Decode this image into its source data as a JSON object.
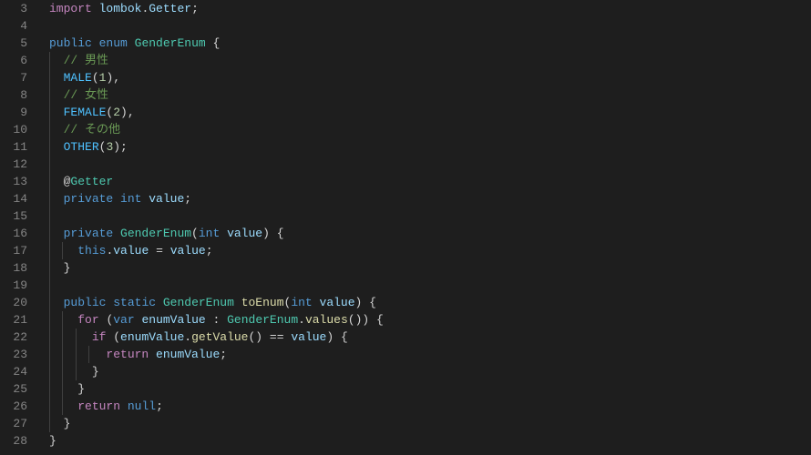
{
  "lines": [
    {
      "num": "3",
      "html": "<span class='kw-control'>import</span> <span class='variable'>lombok</span><span class='punct'>.</span><span class='variable'>Getter</span><span class='punct'>;</span>"
    },
    {
      "num": "4",
      "html": ""
    },
    {
      "num": "5",
      "html": "<span class='kw-modifier'>public</span> <span class='kw-modifier'>enum</span> <span class='class-name'>GenderEnum</span> <span class='punct'>{</span>"
    },
    {
      "num": "6",
      "html": "  <span class='comment'>// 男性</span>"
    },
    {
      "num": "7",
      "html": "  <span class='const'>MALE</span><span class='punct'>(</span><span class='number'>1</span><span class='punct'>),</span>"
    },
    {
      "num": "8",
      "html": "  <span class='comment'>// 女性</span>"
    },
    {
      "num": "9",
      "html": "  <span class='const'>FEMALE</span><span class='punct'>(</span><span class='number'>2</span><span class='punct'>),</span>"
    },
    {
      "num": "10",
      "html": "  <span class='comment'>// その他</span>"
    },
    {
      "num": "11",
      "html": "  <span class='const'>OTHER</span><span class='punct'>(</span><span class='number'>3</span><span class='punct'>);</span>"
    },
    {
      "num": "12",
      "html": ""
    },
    {
      "num": "13",
      "html": "  <span class='punct'>@</span><span class='annotation'>Getter</span>"
    },
    {
      "num": "14",
      "html": "  <span class='kw-modifier'>private</span> <span class='kw-type'>int</span> <span class='variable'>value</span><span class='punct'>;</span>"
    },
    {
      "num": "15",
      "html": ""
    },
    {
      "num": "16",
      "html": "  <span class='kw-modifier'>private</span> <span class='class-name'>GenderEnum</span><span class='punct'>(</span><span class='kw-type'>int</span> <span class='variable'>value</span><span class='punct'>)</span> <span class='punct'>{</span>"
    },
    {
      "num": "17",
      "html": "    <span class='this-kw'>this</span><span class='punct'>.</span><span class='field'>value</span> <span class='operator'>=</span> <span class='variable'>value</span><span class='punct'>;</span>"
    },
    {
      "num": "18",
      "html": "  <span class='punct'>}</span>"
    },
    {
      "num": "19",
      "html": ""
    },
    {
      "num": "20",
      "html": "  <span class='kw-modifier'>public</span> <span class='kw-modifier'>static</span> <span class='class-name'>GenderEnum</span> <span class='method'>toEnum</span><span class='punct'>(</span><span class='kw-type'>int</span> <span class='variable'>value</span><span class='punct'>)</span> <span class='punct'>{</span>"
    },
    {
      "num": "21",
      "html": "    <span class='kw-control'>for</span> <span class='punct'>(</span><span class='kw-type'>var</span> <span class='variable'>enumValue</span> <span class='punct'>:</span> <span class='class-name'>GenderEnum</span><span class='punct'>.</span><span class='method'>values</span><span class='punct'>())</span> <span class='punct'>{</span>"
    },
    {
      "num": "22",
      "html": "      <span class='kw-control'>if</span> <span class='punct'>(</span><span class='variable'>enumValue</span><span class='punct'>.</span><span class='method'>getValue</span><span class='punct'>()</span> <span class='operator'>==</span> <span class='variable'>value</span><span class='punct'>)</span> <span class='punct'>{</span>"
    },
    {
      "num": "23",
      "html": "        <span class='kw-control'>return</span> <span class='variable'>enumValue</span><span class='punct'>;</span>"
    },
    {
      "num": "24",
      "html": "      <span class='punct'>}</span>"
    },
    {
      "num": "25",
      "html": "    <span class='punct'>}</span>"
    },
    {
      "num": "26",
      "html": "    <span class='kw-control'>return</span> <span class='kw-modifier'>null</span><span class='punct'>;</span>"
    },
    {
      "num": "27",
      "html": "  <span class='punct'>}</span>"
    },
    {
      "num": "28",
      "html": "<span class='punct'>}</span>"
    }
  ],
  "indent_guides_at": [
    0
  ]
}
